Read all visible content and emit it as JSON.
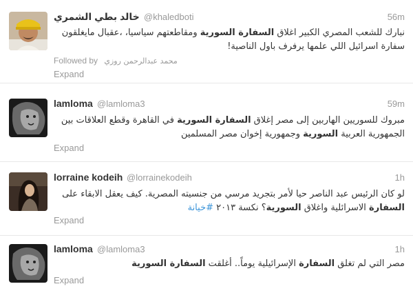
{
  "tweets": [
    {
      "name": "خالد بطي الشمري",
      "handle": "@khaledboti",
      "time": "56m",
      "text_before": "نبارك للشعب المصري الكبير اغلاق ",
      "text_bold": "السفارة السورية",
      "text_after": " ومقاطعتهم سياسيا، ،عقبال مايغلقون سفارة اسرائيل اللي علمها يرفرف باول الناصية!",
      "followed_label": "Followed by",
      "followed_name": "محمد عبدالرحمن روزي",
      "expand": "Expand"
    },
    {
      "name": "lamloma",
      "handle": "@lamloma3",
      "time": "59m",
      "text_p1": "مبروك للسوريين الهاربين إلى مصر إغلاق ",
      "text_b1": "السفارة السورية",
      "text_p2": " في القاهرة وقطع العلاقات بين الجمهورية العربية ",
      "text_b2": "السورية",
      "text_p3": " وجمهورية إخوان مصر المسلمين",
      "expand": "Expand"
    },
    {
      "name": "lorraine kodeih",
      "handle": "@lorrainekodeih",
      "time": "1h",
      "text_p1": "لو كان الرئيس عبد الناصر حيا لأمر بتجريد مرسي من جنسيته المصرية. كيف يعقل الابقاء على ",
      "text_b1": "السفارة",
      "text_p2": " الاسرائلية واغلاق ",
      "text_b2": "السورية",
      "text_p3": "؟ نكسة ٢٠١٣ ",
      "hashtag": "#خيانة",
      "expand": "Expand"
    },
    {
      "name": "lamloma",
      "handle": "@lamloma3",
      "time": "1h",
      "text_p1": "مصر التي لم تغلق ",
      "text_b1": "السفارة",
      "text_p2": " الإسرائيلية يوماً.. أغلقت ",
      "text_b2": "السفارة السورية",
      "expand": "Expand"
    }
  ]
}
